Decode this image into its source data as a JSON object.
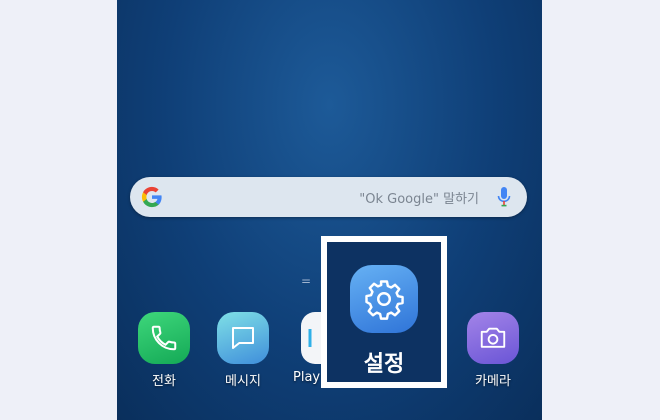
{
  "search": {
    "hint": "\"Ok Google\" 말하기"
  },
  "home": {
    "page_handle": "="
  },
  "dock": [
    {
      "label": "전화",
      "icon": "phone-icon"
    },
    {
      "label": "메시지",
      "icon": "message-icon"
    },
    {
      "label": "Play",
      "icon": "play-store-icon"
    },
    {
      "label": "카메라",
      "icon": "camera-icon"
    }
  ],
  "highlight": {
    "label": "설정",
    "icon": "gear-icon"
  },
  "colors": {
    "highlight_border": "#ffffff",
    "settings_icon": "#3f86e3",
    "phone_icon": "#20bb63",
    "wallpaper": "#0f3f77"
  }
}
